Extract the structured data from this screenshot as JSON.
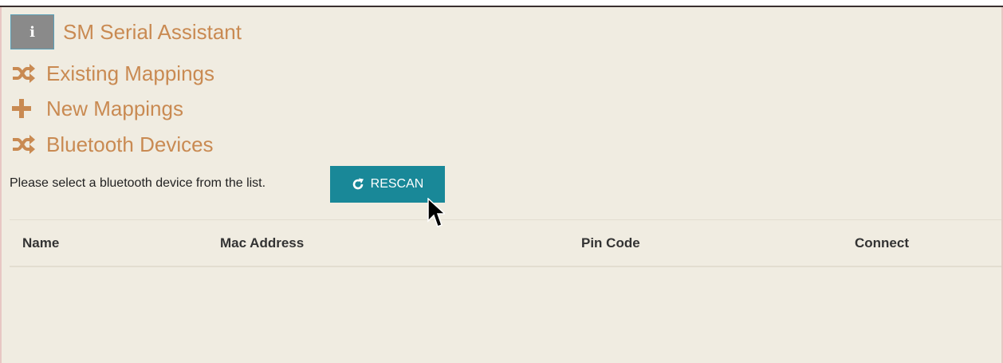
{
  "app": {
    "title": "SM Serial Assistant",
    "info_icon_glyph": "i"
  },
  "nav": {
    "items": [
      {
        "label": "Existing Mappings",
        "icon": "shuffle-icon"
      },
      {
        "label": "New Mappings",
        "icon": "plus-icon"
      },
      {
        "label": "Bluetooth Devices",
        "icon": "shuffle-icon"
      }
    ]
  },
  "bluetooth": {
    "hint": "Please select a bluetooth device from the list.",
    "rescan_label": "RESCAN",
    "rescan_icon": "refresh-icon"
  },
  "table": {
    "columns": [
      "Name",
      "Mac Address",
      "Pin Code",
      "Connect"
    ],
    "rows": []
  },
  "colors": {
    "background": "#f0ece1",
    "accent_text": "#c98a52",
    "button": "#198898"
  }
}
